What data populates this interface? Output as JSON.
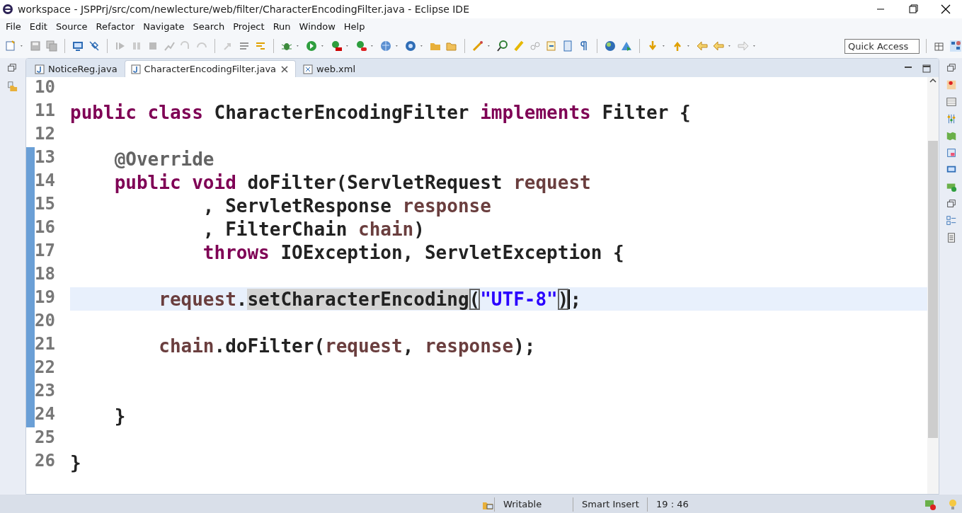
{
  "window": {
    "title": "workspace - JSPPrj/src/com/newlecture/web/filter/CharacterEncodingFilter.java - Eclipse IDE"
  },
  "menu": [
    "File",
    "Edit",
    "Source",
    "Refactor",
    "Navigate",
    "Search",
    "Project",
    "Run",
    "Window",
    "Help"
  ],
  "quick_access": {
    "placeholder": "Quick Access"
  },
  "tabs": [
    {
      "label": "NoticeReg.java",
      "kind": "java",
      "selected": false
    },
    {
      "label": "CharacterEncodingFilter.java",
      "kind": "java",
      "selected": true
    },
    {
      "label": "web.xml",
      "kind": "xml",
      "selected": false
    }
  ],
  "editor": {
    "lines": [
      {
        "number": "10",
        "current": false
      },
      {
        "number": "11",
        "current": false,
        "tokens": [
          {
            "kind": "kw",
            "text": "public class "
          },
          {
            "kind": "plain",
            "text": "CharacterEncodingFilter "
          },
          {
            "kind": "kw",
            "text": "implements "
          },
          {
            "kind": "plain",
            "text": "Filter {"
          }
        ]
      },
      {
        "number": "12",
        "current": false
      },
      {
        "number": "13",
        "current": false,
        "tokens": [
          {
            "kind": "indent1"
          },
          {
            "kind": "ann",
            "text": "@Override"
          }
        ]
      },
      {
        "number": "14",
        "current": false,
        "tokens": [
          {
            "kind": "indent1"
          },
          {
            "kind": "kw",
            "text": "public void "
          },
          {
            "kind": "plain",
            "text": "doFilter(ServletRequest "
          },
          {
            "kind": "param",
            "text": "request"
          }
        ]
      },
      {
        "number": "15",
        "current": false,
        "tokens": [
          {
            "kind": "indent3"
          },
          {
            "kind": "plain",
            "text": ", ServletResponse "
          },
          {
            "kind": "param",
            "text": "response"
          }
        ]
      },
      {
        "number": "16",
        "current": false,
        "tokens": [
          {
            "kind": "indent3"
          },
          {
            "kind": "plain",
            "text": ", FilterChain "
          },
          {
            "kind": "param",
            "text": "chain"
          },
          {
            "kind": "plain",
            "text": ")"
          }
        ]
      },
      {
        "number": "17",
        "current": false,
        "tokens": [
          {
            "kind": "indent3"
          },
          {
            "kind": "kw",
            "text": "throws "
          },
          {
            "kind": "plain",
            "text": "IOException, ServletException {"
          }
        ]
      },
      {
        "number": "18",
        "current": false
      },
      {
        "number": "19",
        "current": true,
        "tokens": [
          {
            "kind": "indent2"
          },
          {
            "kind": "param",
            "text": "request"
          },
          {
            "kind": "plain",
            "text": "."
          },
          {
            "kind": "occurrence",
            "text": "setCharacterEncoding"
          },
          {
            "kind": "bracket",
            "text": "("
          },
          {
            "kind": "str",
            "text": "\"UTF-8\""
          },
          {
            "kind": "bracket",
            "text": ")"
          },
          {
            "kind": "caret"
          },
          {
            "kind": "plain",
            "text": ";"
          }
        ]
      },
      {
        "number": "20",
        "current": false
      },
      {
        "number": "21",
        "current": false,
        "tokens": [
          {
            "kind": "indent2"
          },
          {
            "kind": "param",
            "text": "chain"
          },
          {
            "kind": "plain",
            "text": ".doFilter("
          },
          {
            "kind": "param",
            "text": "request"
          },
          {
            "kind": "plain",
            "text": ", "
          },
          {
            "kind": "param",
            "text": "response"
          },
          {
            "kind": "plain",
            "text": ");"
          }
        ]
      },
      {
        "number": "22",
        "current": false
      },
      {
        "number": "23",
        "current": false
      },
      {
        "number": "24",
        "current": false,
        "tokens": [
          {
            "kind": "indent1"
          },
          {
            "kind": "plain",
            "text": "}"
          }
        ]
      },
      {
        "number": "25",
        "current": false
      },
      {
        "number": "26",
        "current": false,
        "tokens": [
          {
            "kind": "plain",
            "text": "}"
          }
        ]
      }
    ]
  },
  "status_bar": {
    "items": [
      "Writable",
      "Smart Insert",
      "19 : 46"
    ]
  }
}
